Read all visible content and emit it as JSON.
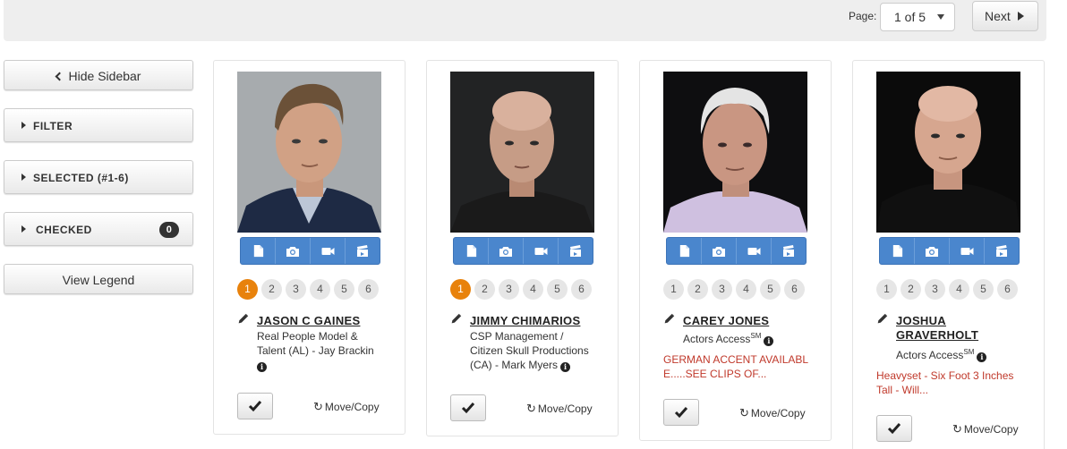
{
  "pagination": {
    "label": "Page:",
    "selected": "1 of 5",
    "next_label": "Next"
  },
  "sidebar": {
    "hide_label": "Hide Sidebar",
    "filter_label": "FILTER",
    "selected_label": "SELECTED (#1-6)",
    "checked_label": "CHECKED",
    "checked_count": "0",
    "legend_label": "View Legend"
  },
  "colors": {
    "toolbar_blue": "#4a86cd",
    "active_number": "#e8820c",
    "note_red": "#c0392b"
  },
  "card_common": {
    "numbers": [
      "1",
      "2",
      "3",
      "4",
      "5",
      "6"
    ],
    "toolbar_icons": [
      "document-icon",
      "camera-icon",
      "video-icon",
      "clapperboard-icon"
    ],
    "move_copy_label": "Move/Copy"
  },
  "cards": [
    {
      "name": "JASON C GAINES",
      "agency_lines": [
        "Real People Model &",
        "Talent (AL) - Jay Brackin"
      ],
      "note": "",
      "active_number": "1"
    },
    {
      "name": "JIMMY CHIMARIOS",
      "agency_lines": [
        "CSP Management /",
        "Citizen Skull Productions",
        "(CA) - Mark Myers"
      ],
      "note": "",
      "active_number": "1"
    },
    {
      "name": "CAREY JONES",
      "agency_lines": [
        "Actors Access"
      ],
      "agency_sup": "SM",
      "note_lines": [
        "GERMAN ACCENT AVAILABL",
        "E.....SEE CLIPS OF..."
      ],
      "active_number": ""
    },
    {
      "name_lines": [
        "JOSHUA",
        "GRAVERHOLT"
      ],
      "agency_lines": [
        "Actors Access"
      ],
      "agency_sup": "SM",
      "note_lines": [
        "Heavyset - Six Foot 3 Inches",
        "Tall - Will..."
      ],
      "active_number": ""
    }
  ]
}
